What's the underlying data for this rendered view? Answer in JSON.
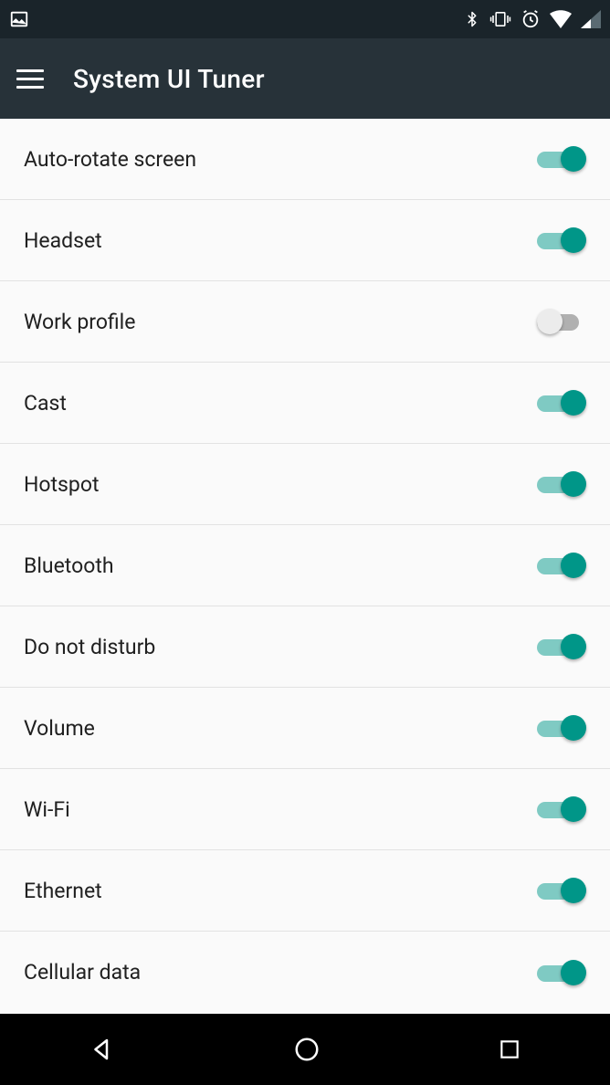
{
  "status": {
    "icons": [
      "image",
      "bluetooth",
      "vibrate",
      "alarm",
      "wifi",
      "signal"
    ]
  },
  "appbar": {
    "title": "System UI Tuner"
  },
  "settings": [
    {
      "key": "auto-rotate",
      "label": "Auto-rotate screen",
      "enabled": true
    },
    {
      "key": "headset",
      "label": "Headset",
      "enabled": true
    },
    {
      "key": "work-profile",
      "label": "Work profile",
      "enabled": false
    },
    {
      "key": "cast",
      "label": "Cast",
      "enabled": true
    },
    {
      "key": "hotspot",
      "label": "Hotspot",
      "enabled": true
    },
    {
      "key": "bluetooth",
      "label": "Bluetooth",
      "enabled": true
    },
    {
      "key": "dnd",
      "label": "Do not disturb",
      "enabled": true
    },
    {
      "key": "volume",
      "label": "Volume",
      "enabled": true
    },
    {
      "key": "wifi",
      "label": "Wi-Fi",
      "enabled": true
    },
    {
      "key": "ethernet",
      "label": "Ethernet",
      "enabled": true
    },
    {
      "key": "cellular",
      "label": "Cellular data",
      "enabled": true
    }
  ]
}
